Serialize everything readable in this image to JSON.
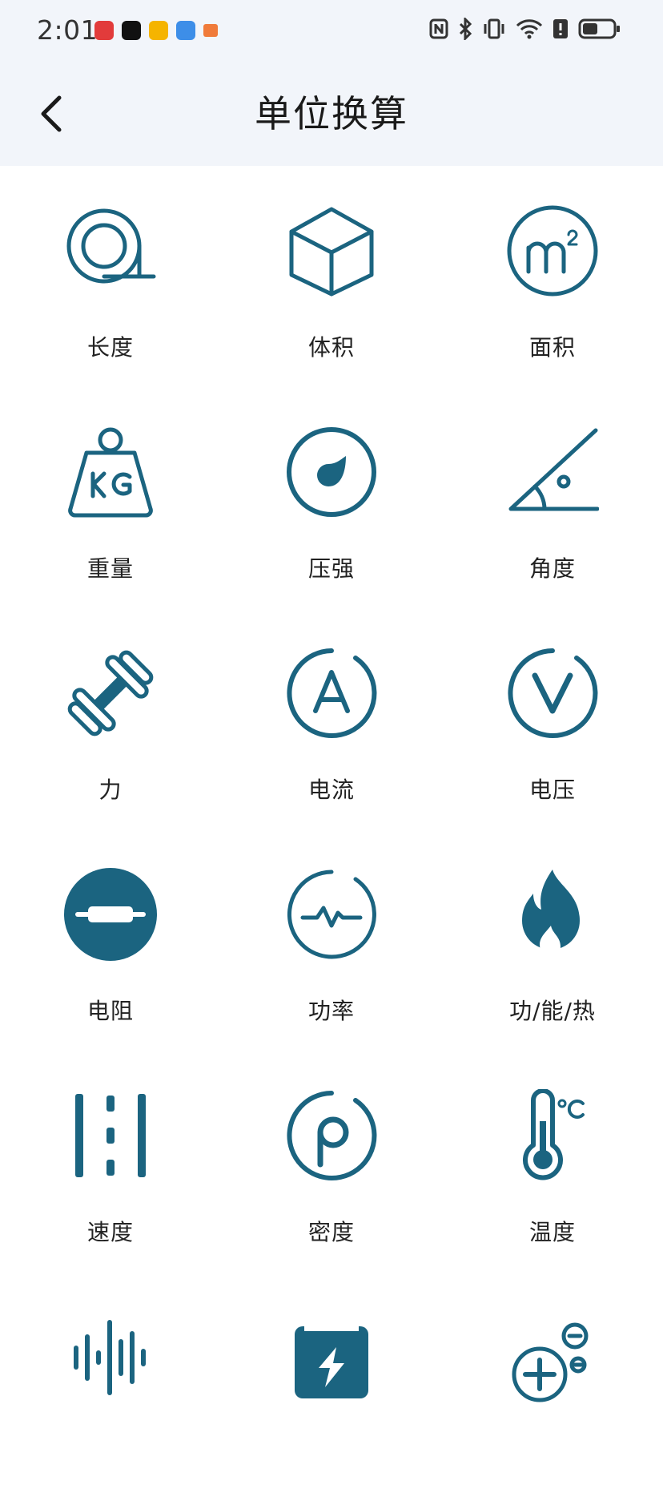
{
  "status_bar": {
    "time": "2:01"
  },
  "header": {
    "title": "单位换算"
  },
  "colors": {
    "accent": "#1b6480",
    "header_bg": "#f2f5fa"
  },
  "items": [
    {
      "label": "长度",
      "icon": "tape-measure-icon"
    },
    {
      "label": "体积",
      "icon": "cube-icon"
    },
    {
      "label": "面积",
      "icon": "square-meter-icon"
    },
    {
      "label": "重量",
      "icon": "kg-weight-icon"
    },
    {
      "label": "压强",
      "icon": "pressure-gauge-icon"
    },
    {
      "label": "角度",
      "icon": "angle-icon"
    },
    {
      "label": "力",
      "icon": "dumbbell-icon"
    },
    {
      "label": "电流",
      "icon": "ampere-icon"
    },
    {
      "label": "电压",
      "icon": "volt-icon"
    },
    {
      "label": "电阻",
      "icon": "resistor-icon"
    },
    {
      "label": "功率",
      "icon": "power-wave-icon"
    },
    {
      "label": "功/能/热",
      "icon": "flame-icon"
    },
    {
      "label": "速度",
      "icon": "speed-lanes-icon"
    },
    {
      "label": "密度",
      "icon": "density-rho-icon"
    },
    {
      "label": "温度",
      "icon": "thermometer-icon"
    },
    {
      "label": "",
      "icon": "sound-wave-icon"
    },
    {
      "label": "",
      "icon": "battery-box-icon"
    },
    {
      "label": "",
      "icon": "plus-minus-icon"
    }
  ]
}
